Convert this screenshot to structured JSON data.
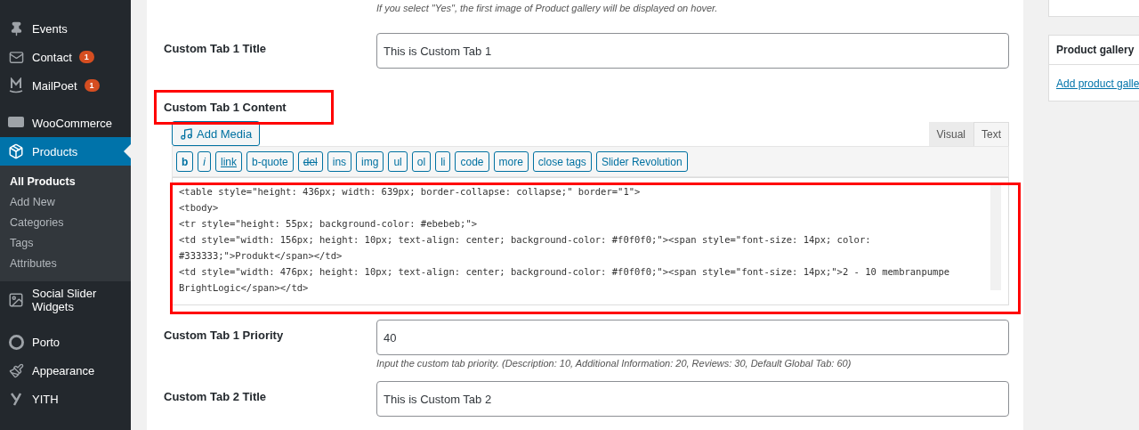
{
  "sidebar": {
    "items": [
      {
        "label": "Events",
        "selected": false
      },
      {
        "label": "Contact",
        "badge": "1",
        "selected": false
      },
      {
        "label": "MailPoet",
        "badge": "1",
        "selected": false
      },
      {
        "label": "WooCommerce",
        "selected": false
      },
      {
        "label": "Products",
        "selected": true,
        "children": [
          {
            "label": "All Products",
            "selected": true
          },
          {
            "label": "Add New",
            "selected": false
          },
          {
            "label": "Categories",
            "selected": false
          },
          {
            "label": "Tags",
            "selected": false
          },
          {
            "label": "Attributes",
            "selected": false
          }
        ]
      },
      {
        "label": "Social Slider Widgets",
        "selected": false
      },
      {
        "label": "Porto",
        "selected": false
      },
      {
        "label": "Appearance",
        "selected": false
      },
      {
        "label": "YITH",
        "selected": false
      }
    ]
  },
  "top_hint": "If you select \"Yes\", the first image of Product gallery will be displayed on hover.",
  "fields": [
    {
      "kind": "input",
      "label": "Custom Tab 1 Title",
      "value": "This is Custom Tab 1"
    },
    {
      "kind": "editor",
      "label": "Custom Tab 1 Content",
      "highlighted": true,
      "add_media": "Add Media",
      "tabs": [
        {
          "label": "Visual",
          "selected": false
        },
        {
          "label": "Text",
          "selected": true
        }
      ],
      "toolbar": [
        "b",
        "i",
        "link",
        "b-quote",
        "del",
        "ins",
        "img",
        "ul",
        "ol",
        "li",
        "code",
        "more",
        "close tags",
        "Slider Revolution"
      ],
      "content_highlighted": true,
      "lines": [
        "<table style=\"height: 436px; width: 639px; border-collapse: collapse;\" border=\"1\">",
        "<tbody>",
        "<tr style=\"height: 55px; background-color: #ebebeb;\">",
        "<td style=\"width: 156px; height: 10px; text-align: center; background-color: #f0f0f0;\"><span style=\"font-size: 14px; color: #333333;\">Produkt</span></td>",
        "<td style=\"width: 476px; height: 10px; text-align: center; background-color: #f0f0f0;\"><span style=\"font-size: 14px;\">2 - 10 membranpumpe BrightLogic</span></td>"
      ]
    },
    {
      "kind": "input",
      "label": "Custom Tab 1 Priority",
      "value": "40",
      "hint": "Input the custom tab priority. (Description: 10, Additional Information: 20, Reviews: 30, Default Global Tab: 60)"
    },
    {
      "kind": "input",
      "label": "Custom Tab 2 Title",
      "value": "This is Custom Tab 2"
    }
  ],
  "right_panel": {
    "title": "Product gallery",
    "link": "Add product galle"
  }
}
